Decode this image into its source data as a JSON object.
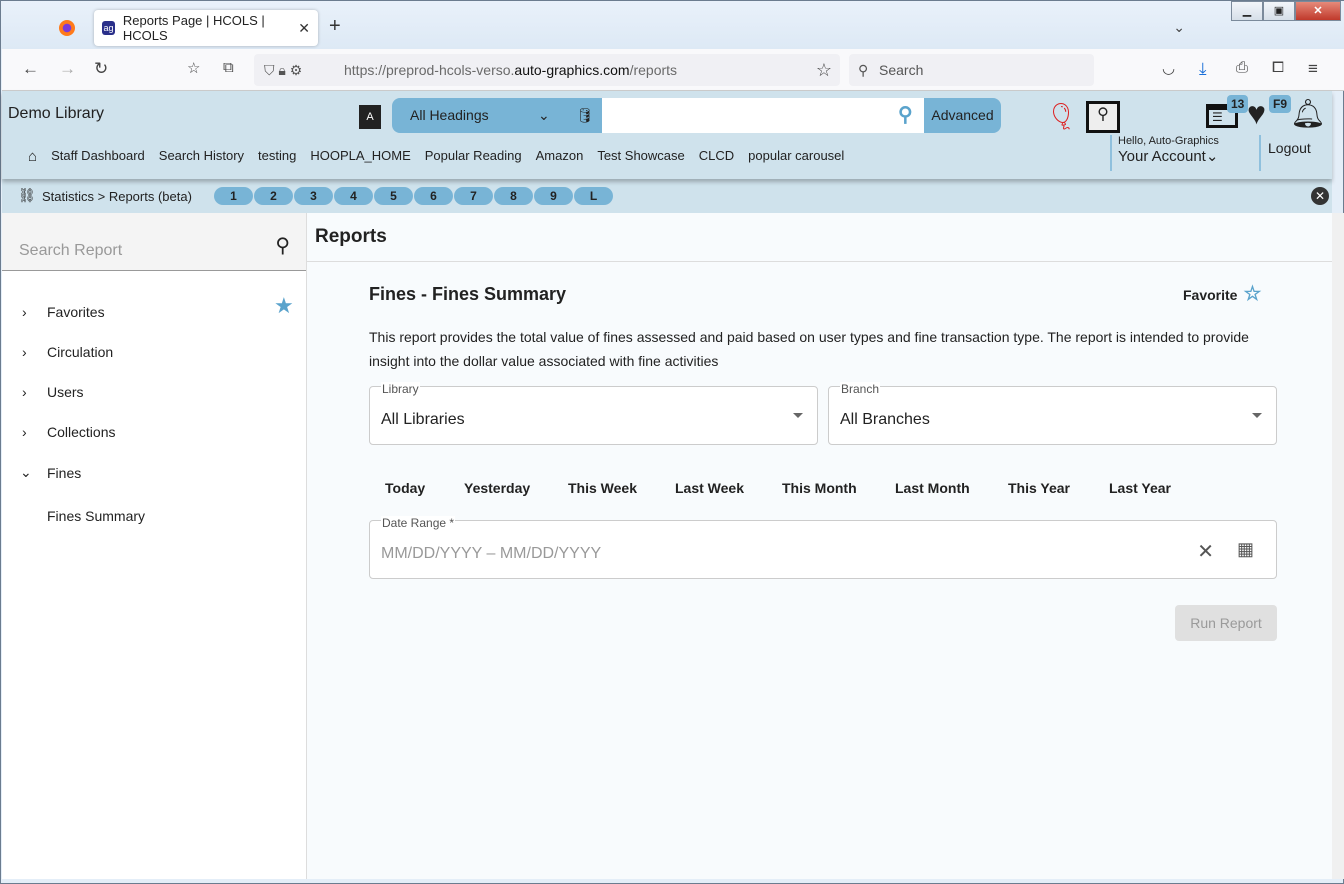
{
  "browser": {
    "tab_title": "Reports Page | HCOLS | HCOLS",
    "url_prefix": "https://preprod-hcols-verso.",
    "url_domain": "auto-graphics.com",
    "url_path": "/reports",
    "search_placeholder": "Search"
  },
  "header": {
    "library": "Demo Library",
    "heading_select": "All Headings",
    "advanced": "Advanced",
    "badge_list": "13",
    "badge_fav": "F9",
    "hello": "Hello, Auto-Graphics",
    "account": "Your Account",
    "logout": "Logout",
    "menu": [
      "Staff Dashboard",
      "Search History",
      "testing",
      "HOOPLA_HOME",
      "Popular Reading",
      "Amazon",
      "Test Showcase",
      "CLCD",
      "popular carousel"
    ]
  },
  "breadcrumb": {
    "path": "Statistics > Reports (beta)",
    "pills": [
      "1",
      "2",
      "3",
      "4",
      "5",
      "6",
      "7",
      "8",
      "9",
      "L"
    ]
  },
  "sidebar": {
    "search_placeholder": "Search Report",
    "items": [
      "Favorites",
      "Circulation",
      "Users",
      "Collections",
      "Fines"
    ],
    "sub_items": [
      "Fines Summary"
    ]
  },
  "main": {
    "title": "Reports",
    "report_title": "Fines - Fines Summary",
    "favorite": "Favorite",
    "description": "This report provides the total value of fines assessed and paid based on user types and fine transaction type. The report is intended to provide insight into the dollar value associated with fine activities",
    "library_label": "Library",
    "library_value": "All Libraries",
    "branch_label": "Branch",
    "branch_value": "All Branches",
    "quick_ranges": [
      "Today",
      "Yesterday",
      "This Week",
      "Last Week",
      "This Month",
      "Last Month",
      "This Year",
      "Last Year"
    ],
    "date_label": "Date Range *",
    "date_placeholder": "MM/DD/YYYY – MM/DD/YYYY",
    "run": "Run Report"
  }
}
